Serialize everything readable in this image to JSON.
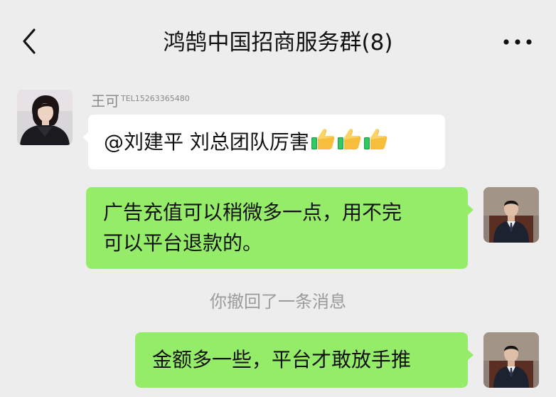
{
  "header": {
    "title": "鸿鹄中国招商服务群(8)",
    "back_icon": "chevron-left-icon",
    "more_icon": "ellipsis-icon"
  },
  "messages": [
    {
      "sender": "王可",
      "sender_tel": "TEL15263365480",
      "side": "left",
      "text": "@刘建平  刘总团队厉害",
      "emoji": [
        "thumbs-up-icon",
        "thumbs-up-icon",
        "thumbs-up-icon"
      ]
    },
    {
      "side": "right",
      "line1": "广告充值可以稍微多一点，用不完",
      "line2": "可以平台退款的。"
    },
    {
      "side": "system",
      "text": "你撤回了一条消息"
    },
    {
      "side": "right",
      "text": "金额多一些，平台才敢放手推"
    }
  ],
  "colors": {
    "background": "#ededed",
    "bubble_self": "#95ec69",
    "bubble_other": "#ffffff",
    "meta_text": "#8a8a8a"
  }
}
